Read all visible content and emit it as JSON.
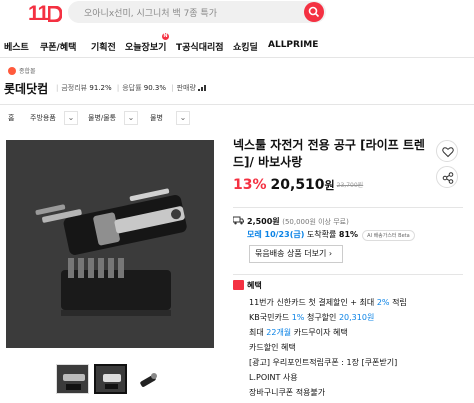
{
  "header": {
    "logo": "11",
    "search_placeholder": "오아니x선미, 시그니처 백 7종 특가"
  },
  "gnb": {
    "items": [
      "베스트",
      "쿠폰/혜택",
      "기획전",
      "오늘장보기",
      "T공식대리점",
      "쇼킹딜",
      "ALLPRIME"
    ],
    "new_badge": "N"
  },
  "seller": {
    "badge": "종합몰",
    "name": "롯데닷컴",
    "stats": [
      {
        "label": "금정리뷰",
        "value": "91.2%"
      },
      {
        "label": "응답률",
        "value": "90.3%"
      },
      {
        "label": "판매량",
        "value": ""
      }
    ]
  },
  "breadcrumb": [
    "홈",
    "주방용품",
    "물병/물통",
    "물병"
  ],
  "product": {
    "title": "넥스툴 자전거 전용 공구 [라이프 트렌드]/ 바보사랑",
    "discount": "13%",
    "price": "20,510",
    "won": "원",
    "original_price": "23,700원"
  },
  "shipping": {
    "fee": "2,500원",
    "condition": "(50,000원 이상 무료)",
    "arrival_date": "모레 10/23(금)",
    "arrival_text": "도착확률",
    "arrival_pct": "81%",
    "ai_badge": "AI 배송가스터 Beta",
    "bundle_button": "묶음배송 상품 더보기 ›"
  },
  "benefits": {
    "header": "혜택",
    "lines": [
      {
        "pre": "11번가 신한카드 첫 결제할인 + 최대 ",
        "hl": "2%",
        "post": " 적립"
      },
      {
        "pre": "KB국민카드 ",
        "hl": "1%",
        "post": " 청구할인 ",
        "hl2": "20,310원"
      },
      {
        "pre": "최대 ",
        "hl": "22개월",
        "post": " 카드무이자 혜택"
      },
      {
        "pre": "카드할인 혜택",
        "hl": "",
        "post": ""
      },
      {
        "pre": "[광고] 우리포인트적립쿠폰 : 1장 [쿠폰받기]",
        "hl": "",
        "post": ""
      },
      {
        "pre": "L.POINT 사용",
        "hl": "",
        "post": ""
      },
      {
        "pre": "장바구니쿠폰 적용불가",
        "hl": "",
        "post": ""
      }
    ]
  },
  "colors": {
    "brand": "#f43142",
    "link": "#0b83e6"
  },
  "icons": [
    "search-icon",
    "heart-icon",
    "share-icon",
    "truck-icon",
    "chevron-down-icon"
  ]
}
